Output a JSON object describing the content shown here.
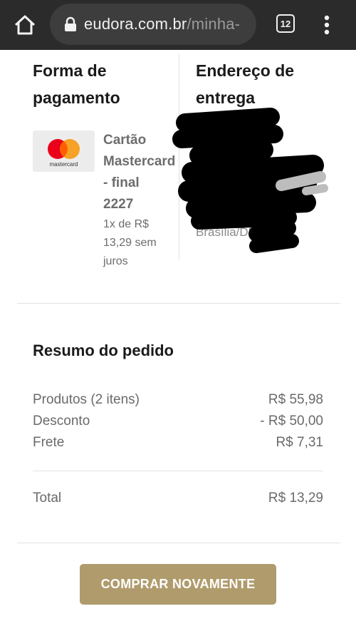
{
  "browser": {
    "url_host": "eudora.com.br",
    "url_path": "/minha-",
    "tab_count": "12"
  },
  "payment": {
    "heading": "Forma de pagamento",
    "card_brand_logo_text": "mastercard",
    "card_line1": "Cartão",
    "card_line2": "Mastercard",
    "card_line3": "- final",
    "card_line4": "2227",
    "installment_line1": "1x de R$",
    "installment_line2": "13,29 sem",
    "installment_line3": "juros"
  },
  "address": {
    "heading": "Endereço de entrega",
    "city": "Brasília/DF"
  },
  "summary": {
    "title": "Resumo do pedido",
    "rows": [
      {
        "label": "Produtos (2 itens)",
        "value": "R$ 55,98"
      },
      {
        "label": "Desconto",
        "value": "- R$ 50,00"
      },
      {
        "label": "Frete",
        "value": "R$ 7,31"
      }
    ],
    "total_label": "Total",
    "total_value": "R$ 13,29"
  },
  "actions": {
    "buy_again": "COMPRAR NOVAMENTE"
  },
  "colors": {
    "chrome": "#2b2b2b",
    "button": "#b09b6c",
    "mastercard_red": "#eb001b",
    "mastercard_orange": "#f79e1b"
  }
}
